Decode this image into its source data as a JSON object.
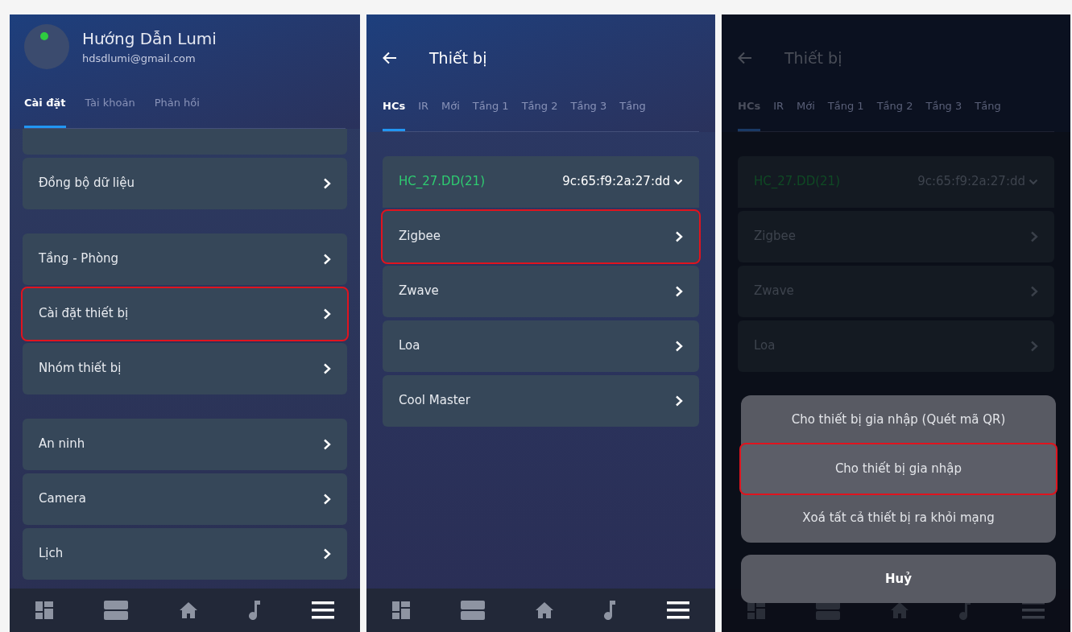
{
  "panels": [
    {
      "kind": "settings",
      "profile": {
        "name": "Hướng Dẫn Lumi",
        "email": "hdsdlumi@gmail.com"
      },
      "tabs": [
        {
          "label": "Cài đặt",
          "selected": true
        },
        {
          "label": "Tài khoản",
          "selected": false
        },
        {
          "label": "Phản hồi",
          "selected": false
        }
      ],
      "groups": [
        [
          {
            "kind": "partial",
            "highlighted": false
          },
          {
            "kind": "link",
            "label": "Đồng bộ dữ liệu",
            "highlighted": false
          }
        ],
        [
          {
            "kind": "link",
            "label": "Tầng - Phòng",
            "highlighted": false
          },
          {
            "kind": "link",
            "label": "Cài đặt thiết bị",
            "highlighted": true
          },
          {
            "kind": "link",
            "label": "Nhóm thiết bị",
            "highlighted": false
          }
        ],
        [
          {
            "kind": "link",
            "label": "An ninh",
            "highlighted": false
          },
          {
            "kind": "link",
            "label": "Camera",
            "highlighted": false
          },
          {
            "kind": "link",
            "label": "Lịch",
            "highlighted": false
          }
        ]
      ],
      "nav": [
        {
          "selected": false
        },
        {
          "selected": false
        },
        {
          "selected": false
        },
        {
          "selected": false
        },
        {
          "selected": true
        }
      ]
    },
    {
      "kind": "devices",
      "title": "Thiết bị",
      "tabs": [
        {
          "label": "HCs",
          "selected": true
        },
        {
          "label": "IR",
          "selected": false
        },
        {
          "label": "Mới",
          "selected": false
        },
        {
          "label": "Tầng 1",
          "selected": false
        },
        {
          "label": "Tầng 2",
          "selected": false
        },
        {
          "label": "Tầng 3",
          "selected": false
        },
        {
          "label": "Tầng",
          "selected": false
        }
      ],
      "hub": {
        "name": "HC_27.DD(21)",
        "mac": "9c:65:f9:2a:27:dd"
      },
      "items": [
        {
          "label": "Zigbee",
          "highlighted": true
        },
        {
          "label": "Zwave",
          "highlighted": false
        },
        {
          "label": "Loa",
          "highlighted": false
        },
        {
          "label": "Cool Master",
          "highlighted": false
        }
      ],
      "nav": [
        {
          "selected": false
        },
        {
          "selected": false
        },
        {
          "selected": false
        },
        {
          "selected": false
        },
        {
          "selected": true
        }
      ]
    },
    {
      "kind": "devices",
      "dimmed": true,
      "title": "Thiết bị",
      "tabs": [
        {
          "label": "HCs",
          "selected": true
        },
        {
          "label": "IR",
          "selected": false
        },
        {
          "label": "Mới",
          "selected": false
        },
        {
          "label": "Tầng 1",
          "selected": false
        },
        {
          "label": "Tầng 2",
          "selected": false
        },
        {
          "label": "Tầng 3",
          "selected": false
        },
        {
          "label": "Tầng",
          "selected": false
        }
      ],
      "hub": {
        "name": "HC_27.DD(21)",
        "mac": "9c:65:f9:2a:27:dd"
      },
      "items": [
        {
          "label": "Zigbee",
          "highlighted": false
        },
        {
          "label": "Zwave",
          "highlighted": false
        },
        {
          "label": "Loa",
          "highlighted": false
        }
      ],
      "action_sheet": {
        "options": [
          {
            "label": "Cho thiết bị gia nhập (Quét mã QR)",
            "highlighted": false
          },
          {
            "label": "Cho thiết bị gia nhập",
            "highlighted": true
          },
          {
            "label": "Xoá tất cả thiết bị ra khỏi mạng",
            "highlighted": false
          }
        ],
        "cancel": "Huỷ"
      },
      "nav": [
        {
          "selected": false
        },
        {
          "selected": false
        },
        {
          "selected": false
        },
        {
          "selected": false
        },
        {
          "selected": true
        }
      ]
    }
  ]
}
